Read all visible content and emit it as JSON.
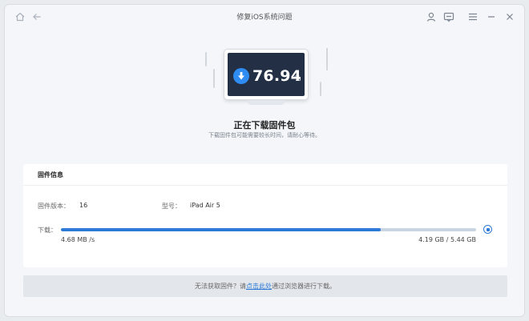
{
  "window": {
    "title": "修复iOS系统问题"
  },
  "titlebar_icons": [
    "home-icon",
    "back-arrow-icon",
    "user-icon",
    "feedback-icon",
    "menu-icon",
    "minimize-icon",
    "close-icon"
  ],
  "progress": {
    "percent_value": "76.94",
    "percent_sign": "%",
    "fraction": 0.7694
  },
  "status": {
    "title": "正在下载固件包",
    "subtitle": "下载固件包可能需要较长时间，请耐心等待。"
  },
  "firmware": {
    "section_title": "固件信息",
    "version_label": "固件版本：",
    "version_value": "16",
    "model_label": "型号：",
    "model_value": "iPad Air 5",
    "download_label": "下载：",
    "speed": "4.68 MB /s",
    "size_progress": "4.19 GB / 5.44 GB"
  },
  "footer": {
    "prefix": "无法获取固件？请",
    "link": "点击此处",
    "suffix": "通过浏览器进行下载。"
  },
  "colors": {
    "accent": "#2d7ad6",
    "screen_bg": "#222f44",
    "download_icon": "#2f8cf2"
  }
}
